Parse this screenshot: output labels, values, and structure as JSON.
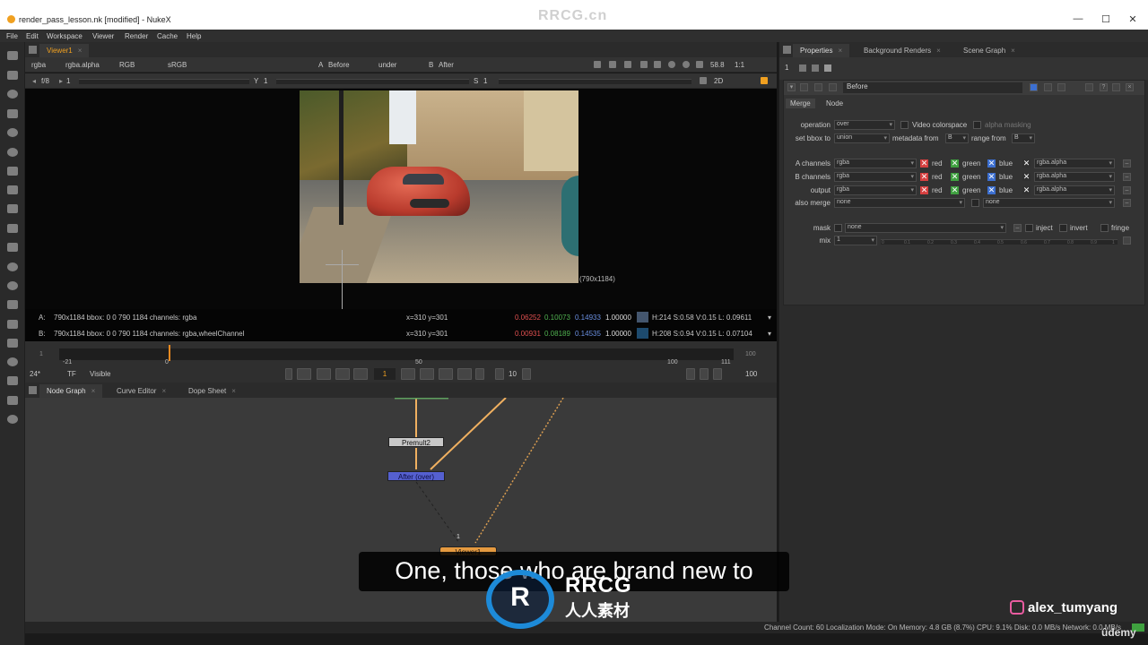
{
  "window": {
    "title": "render_pass_lesson.nk [modified] - NukeX",
    "watermark": "RRCG.cn",
    "controls": [
      "—",
      "☐",
      "✕"
    ]
  },
  "menu": [
    "File",
    "Edit",
    "Workspace",
    "Viewer",
    "Render",
    "Cache",
    "Help"
  ],
  "viewer": {
    "tab": "Viewer1",
    "tab_close": "×",
    "channels": "rgba",
    "alpha": "rgba.alpha",
    "display": "RGB",
    "colorspace": "sRGB",
    "a_label": "A",
    "a_input": "Before",
    "wipe_mode": "under",
    "b_label": "B",
    "b_input": "After",
    "zoom": "58.8",
    "ratio": "1:1",
    "fstop": "f/8",
    "gain": "1",
    "y_label": "Y",
    "gamma": "1",
    "s_label": "S",
    "saturation": "1",
    "view_mode": "2D",
    "image_size": "(790x1184)",
    "info_a": {
      "label": "A:",
      "bbox": "790x1184  bbox: 0 0 790 1184 channels: rgba",
      "xy": "x=310 y=301",
      "r": "0.06252",
      "g": "0.10073",
      "b": "0.14933",
      "a": "1.00000",
      "swatch": "#44566e",
      "hsvl": "H:214 S:0.58 V:0.15  L: 0.09611"
    },
    "info_b": {
      "label": "B:",
      "bbox": "790x1184  bbox: 0 0 790 1184 channels: rgba,wheelChannel",
      "xy": "x=310 y=301",
      "r": "0.00931",
      "g": "0.08189",
      "b": "0.14535",
      "a": "1.00000",
      "swatch": "#1d4a6e",
      "hsvl": "H:208 S:0.94 V:0.15  L: 0.07104"
    }
  },
  "timeline": {
    "start": "1",
    "end": "100",
    "ticks": [
      "-21",
      "0",
      "50",
      "100",
      "111"
    ],
    "fps": "24*",
    "tf": "TF",
    "visible": "Visible",
    "frame": "1",
    "step": "10",
    "end_frame": "100"
  },
  "node_panel": {
    "tabs": [
      "Node Graph",
      "Curve Editor",
      "Dope Sheet"
    ],
    "nodes": [
      "Premult2",
      "After (over)",
      "Viewer1"
    ],
    "input_label": "1"
  },
  "subtitle": "One, those who are brand new to",
  "overlay": {
    "logo_mark": "R",
    "logo_text": "RRCG",
    "logo_sub": "人人素材",
    "instagram": "alex_tumyang",
    "udemy": "ûdemy"
  },
  "status": "Channel Count: 60  Localization Mode: On  Memory: 4.8 GB (8.7%)  CPU: 9.1%  Disk: 0.0 MB/s  Network: 0.0 MB/s",
  "properties": {
    "tabs": [
      "Properties",
      "Background Renders",
      "Scene Graph"
    ],
    "max_panels": "1",
    "node_name": "Before",
    "sub_tabs": [
      "Merge",
      "Node"
    ],
    "operation_label": "operation",
    "operation": "over",
    "video_colorspace": "Video colorspace",
    "alpha_masking": "alpha masking",
    "bbox_label": "set bbox to",
    "bbox": "union",
    "metadata_label": "metadata from",
    "metadata": "B",
    "range_label": "range from",
    "range": "B",
    "channels": [
      {
        "label": "A channels",
        "value": "rgba",
        "alpha": "rgba.alpha"
      },
      {
        "label": "B channels",
        "value": "rgba",
        "alpha": "rgba.alpha"
      },
      {
        "label": "output",
        "value": "rgba",
        "alpha": "rgba.alpha"
      }
    ],
    "rgb_labels": [
      "red",
      "green",
      "blue"
    ],
    "also_merge_label": "also merge",
    "also_merge": "none",
    "also_merge2": "none",
    "mask_label": "mask",
    "mask": "none",
    "inject": "inject",
    "invert": "invert",
    "fringe": "fringe",
    "mix_label": "mix",
    "mix": "1",
    "mix_ticks": [
      "0",
      "0.1",
      "0.2",
      "0.3",
      "0.4",
      "0.5",
      "0.6",
      "0.7",
      "0.8",
      "0.9",
      "1"
    ]
  }
}
